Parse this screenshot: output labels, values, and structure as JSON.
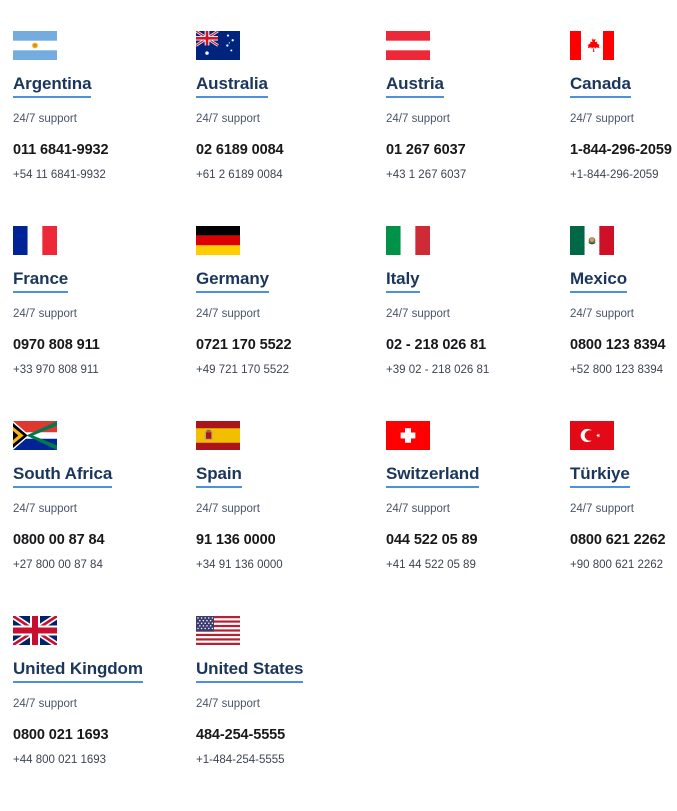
{
  "page": {
    "support_label": "24/7 support",
    "accent_color": "#4b92db",
    "name_color": "#1b365d",
    "phone_color": "#18181b",
    "muted_color": "#4a5568",
    "background_color": "#ffffff"
  },
  "countries": [
    {
      "name": "Argentina",
      "flag": "flag-argentina-icon",
      "support": "24/7 support",
      "phone_local": "011 6841-9932",
      "phone_international": "+54 11 6841-9932"
    },
    {
      "name": "Australia",
      "flag": "flag-australia-icon",
      "support": "24/7 support",
      "phone_local": "02 6189 0084",
      "phone_international": "+61 2 6189 0084"
    },
    {
      "name": "Austria",
      "flag": "flag-austria-icon",
      "support": "24/7 support",
      "phone_local": "01 267 6037",
      "phone_international": "+43 1 267 6037"
    },
    {
      "name": "Canada",
      "flag": "flag-canada-icon",
      "support": "24/7 support",
      "phone_local": "1-844-296-2059",
      "phone_international": "+1-844-296-2059"
    },
    {
      "name": "France",
      "flag": "flag-france-icon",
      "support": "24/7 support",
      "phone_local": "0970 808 911",
      "phone_international": "+33 970 808 911"
    },
    {
      "name": "Germany",
      "flag": "flag-germany-icon",
      "support": "24/7 support",
      "phone_local": "0721 170 5522",
      "phone_international": "+49 721 170 5522"
    },
    {
      "name": "Italy",
      "flag": "flag-italy-icon",
      "support": "24/7 support",
      "phone_local": "02 - 218 026 81",
      "phone_international": "+39 02 - 218 026 81"
    },
    {
      "name": "Mexico",
      "flag": "flag-mexico-icon",
      "support": "24/7 support",
      "phone_local": "0800 123 8394",
      "phone_international": "+52 800 123 8394"
    },
    {
      "name": "South Africa",
      "flag": "flag-south-africa-icon",
      "support": "24/7 support",
      "phone_local": "0800 00 87 84",
      "phone_international": "+27 800 00 87 84"
    },
    {
      "name": "Spain",
      "flag": "flag-spain-icon",
      "support": "24/7 support",
      "phone_local": "91 136 0000",
      "phone_international": "+34 91 136 0000"
    },
    {
      "name": "Switzerland",
      "flag": "flag-switzerland-icon",
      "support": "24/7 support",
      "phone_local": "044 522 05 89",
      "phone_international": "+41 44 522 05 89"
    },
    {
      "name": "Türkiye",
      "flag": "flag-turkiye-icon",
      "support": "24/7 support",
      "phone_local": "0800 621 2262",
      "phone_international": "+90 800 621 2262"
    },
    {
      "name": "United Kingdom",
      "flag": "flag-united-kingdom-icon",
      "support": "24/7 support",
      "phone_local": "0800 021 1693",
      "phone_international": "+44 800 021 1693"
    },
    {
      "name": "United States",
      "flag": "flag-united-states-icon",
      "support": "24/7 support",
      "phone_local": "484-254-5555",
      "phone_international": "+1-484-254-5555"
    }
  ]
}
